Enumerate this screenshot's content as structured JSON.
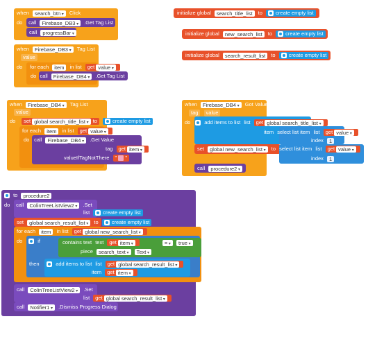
{
  "b1": {
    "when": "when",
    "comp": "search_btn",
    "event": "Click",
    "do": "do",
    "call1": "call",
    "comp1": "Firebase_DB3",
    "method1": ".Get Tag List",
    "call2": "call",
    "comp2": "progressBar"
  },
  "b2": {
    "when": "when",
    "comp": "Firebase_DB3",
    "event": "Tag List",
    "param": "value",
    "do": "do",
    "for_each": "for each",
    "item": "item",
    "in_list": "in list",
    "get": "get",
    "get_val": "value",
    "do2": "do",
    "call": "call",
    "comp2": "Firebase_DB4",
    "method2": ".Get Tag List"
  },
  "g1": {
    "init": "initialize global",
    "name": "search_title_list",
    "to": "to",
    "create": "create empty list"
  },
  "g2": {
    "init": "initialize global",
    "name": "new_search_list",
    "to": "to",
    "create": "create empty list"
  },
  "g3": {
    "init": "initialize global",
    "name": "search_result_list",
    "to": "to",
    "create": "create empty list"
  },
  "b3": {
    "when": "when",
    "comp": "Firebase_DB4",
    "event": "Tag List",
    "param": "value",
    "do": "do",
    "set": "set",
    "var": "global search_title_list",
    "to": "to",
    "create": "create empty list",
    "for_each": "for each",
    "item": "item",
    "in_list": "in list",
    "get": "get",
    "get_val": "value",
    "do2": "do",
    "call": "call",
    "comp2": "Firebase_DB4",
    "method": ".Get Value",
    "tag": "tag",
    "get2": "get",
    "get2_val": "item",
    "vitnt": "valueIfTagNotThere",
    "str": "\""
  },
  "b4": {
    "when": "when",
    "comp": "Firebase_DB4",
    "event": "Got Value",
    "p1": "tag",
    "p2": "value",
    "do": "do",
    "add": "add items to list",
    "list": "list",
    "get": "get",
    "list_var": "global search_title_list",
    "item": "item",
    "select": "select list item",
    "list2": "list",
    "get2": "get",
    "get2_val": "value",
    "index": "index",
    "idx": "1",
    "set": "set",
    "var": "global new_search_list",
    "to": "to",
    "select2": "select list item",
    "list3": "list",
    "get3": "get",
    "get3_val": "value",
    "index2": "index",
    "idx2": "1",
    "call": "call",
    "proc": "procedure2"
  },
  "b5": {
    "to": "to",
    "proc": "procedure2",
    "do": "do",
    "call1": "call",
    "comp1": "ColinTreeListView2",
    "set1": ".Set",
    "list": "list",
    "create1": "create empty list",
    "set": "set",
    "var": "global search_result_list",
    "to2": "to",
    "create2": "create empty list",
    "for_each": "for each",
    "item": "item",
    "in_list": "in list",
    "get": "get",
    "get_val": "global new_search_list",
    "do2": "do",
    "if": "if",
    "contains": "contains text",
    "text": "text",
    "get2": "get",
    "get2_val": "item",
    "eq": "=",
    "true": "true",
    "piece": "piece",
    "piece_val": "search_text",
    "piece_prop": "Text",
    "then": "then",
    "add": "add items to list",
    "list2": "list",
    "get3": "get",
    "get3_val": "global search_result_list",
    "item2": "item",
    "get4": "get",
    "get4_val": "item",
    "call2": "call",
    "comp2": "ColinTreeListView2",
    "set2": ".Set",
    "list3": "list",
    "get5": "get",
    "get5_val": "global search_result_list",
    "call3": "call",
    "comp3": "Notifier1",
    "method3": ".Dismiss Progress Dialog"
  }
}
